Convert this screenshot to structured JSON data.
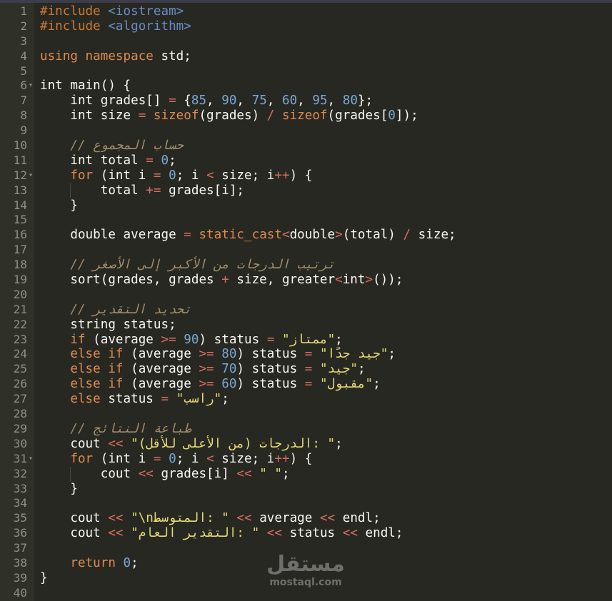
{
  "lines": [
    {
      "n": "1",
      "tokens": [
        {
          "t": "#include ",
          "c": "pp"
        },
        {
          "t": "<iostream>",
          "c": "inc"
        }
      ]
    },
    {
      "n": "2",
      "tokens": [
        {
          "t": "#include ",
          "c": "pp"
        },
        {
          "t": "<algorithm>",
          "c": "inc"
        }
      ]
    },
    {
      "n": "3",
      "tokens": []
    },
    {
      "n": "4",
      "tokens": [
        {
          "t": "using namespace ",
          "c": "kw"
        },
        {
          "t": "std;",
          "c": ""
        }
      ]
    },
    {
      "n": "5",
      "tokens": []
    },
    {
      "n": "6",
      "fold": true,
      "tokens": [
        {
          "t": "int main() {",
          "c": ""
        }
      ]
    },
    {
      "n": "7",
      "tokens": [
        {
          "t": "    int grades[] ",
          "c": ""
        },
        {
          "t": "=",
          "c": "op"
        },
        {
          "t": " {",
          "c": ""
        },
        {
          "t": "85",
          "c": "num"
        },
        {
          "t": ", ",
          "c": ""
        },
        {
          "t": "90",
          "c": "num"
        },
        {
          "t": ", ",
          "c": ""
        },
        {
          "t": "75",
          "c": "num"
        },
        {
          "t": ", ",
          "c": ""
        },
        {
          "t": "60",
          "c": "num"
        },
        {
          "t": ", ",
          "c": ""
        },
        {
          "t": "95",
          "c": "num"
        },
        {
          "t": ", ",
          "c": ""
        },
        {
          "t": "80",
          "c": "num"
        },
        {
          "t": "};",
          "c": ""
        }
      ]
    },
    {
      "n": "8",
      "tokens": [
        {
          "t": "    int size ",
          "c": ""
        },
        {
          "t": "=",
          "c": "op"
        },
        {
          "t": " ",
          "c": ""
        },
        {
          "t": "sizeof",
          "c": "kw"
        },
        {
          "t": "(grades) ",
          "c": ""
        },
        {
          "t": "/",
          "c": "op"
        },
        {
          "t": " ",
          "c": ""
        },
        {
          "t": "sizeof",
          "c": "kw"
        },
        {
          "t": "(grades[",
          "c": ""
        },
        {
          "t": "0",
          "c": "num"
        },
        {
          "t": "]);",
          "c": ""
        }
      ]
    },
    {
      "n": "9",
      "tokens": []
    },
    {
      "n": "10",
      "tokens": [
        {
          "t": "    ",
          "c": ""
        },
        {
          "t": "// حساب المجموع",
          "c": "cm"
        }
      ]
    },
    {
      "n": "11",
      "tokens": [
        {
          "t": "    int total ",
          "c": ""
        },
        {
          "t": "=",
          "c": "op"
        },
        {
          "t": " ",
          "c": ""
        },
        {
          "t": "0",
          "c": "num"
        },
        {
          "t": ";",
          "c": ""
        }
      ]
    },
    {
      "n": "12",
      "fold": true,
      "tokens": [
        {
          "t": "    ",
          "c": ""
        },
        {
          "t": "for",
          "c": "kw"
        },
        {
          "t": " (int i ",
          "c": ""
        },
        {
          "t": "=",
          "c": "op"
        },
        {
          "t": " ",
          "c": ""
        },
        {
          "t": "0",
          "c": "num"
        },
        {
          "t": "; i ",
          "c": ""
        },
        {
          "t": "<",
          "c": "op"
        },
        {
          "t": " size; i",
          "c": ""
        },
        {
          "t": "++",
          "c": "op"
        },
        {
          "t": ") {",
          "c": ""
        }
      ]
    },
    {
      "n": "13",
      "tokens": [
        {
          "t": "        total ",
          "c": ""
        },
        {
          "t": "+=",
          "c": "op"
        },
        {
          "t": " grades[i];",
          "c": ""
        }
      ]
    },
    {
      "n": "14",
      "tokens": [
        {
          "t": "    }",
          "c": ""
        }
      ]
    },
    {
      "n": "15",
      "tokens": []
    },
    {
      "n": "16",
      "tokens": [
        {
          "t": "    double average ",
          "c": ""
        },
        {
          "t": "=",
          "c": "op"
        },
        {
          "t": " ",
          "c": ""
        },
        {
          "t": "static_cast",
          "c": "kw"
        },
        {
          "t": "<",
          "c": "op"
        },
        {
          "t": "double",
          "c": ""
        },
        {
          "t": ">",
          "c": "op"
        },
        {
          "t": "(total) ",
          "c": ""
        },
        {
          "t": "/",
          "c": "op"
        },
        {
          "t": " size;",
          "c": ""
        }
      ]
    },
    {
      "n": "17",
      "tokens": []
    },
    {
      "n": "18",
      "tokens": [
        {
          "t": "    ",
          "c": ""
        },
        {
          "t": "// ترتيب الدرجات من الأكبر إلى الأصغر",
          "c": "cm"
        }
      ]
    },
    {
      "n": "19",
      "tokens": [
        {
          "t": "    sort(grades, grades ",
          "c": ""
        },
        {
          "t": "+",
          "c": "op"
        },
        {
          "t": " size, greater",
          "c": ""
        },
        {
          "t": "<",
          "c": "op"
        },
        {
          "t": "int",
          "c": ""
        },
        {
          "t": ">",
          "c": "op"
        },
        {
          "t": "());",
          "c": ""
        }
      ]
    },
    {
      "n": "20",
      "tokens": []
    },
    {
      "n": "21",
      "tokens": [
        {
          "t": "    ",
          "c": ""
        },
        {
          "t": "// تحديد التقدير",
          "c": "cm"
        }
      ]
    },
    {
      "n": "22",
      "tokens": [
        {
          "t": "    string status;",
          "c": ""
        }
      ]
    },
    {
      "n": "23",
      "tokens": [
        {
          "t": "    ",
          "c": ""
        },
        {
          "t": "if",
          "c": "kw"
        },
        {
          "t": " (average ",
          "c": ""
        },
        {
          "t": ">=",
          "c": "op"
        },
        {
          "t": " ",
          "c": ""
        },
        {
          "t": "90",
          "c": "num"
        },
        {
          "t": ") status ",
          "c": ""
        },
        {
          "t": "=",
          "c": "op"
        },
        {
          "t": " ",
          "c": ""
        },
        {
          "t": "\"ممتاز\"",
          "c": "str"
        },
        {
          "t": ";",
          "c": ""
        }
      ]
    },
    {
      "n": "24",
      "tokens": [
        {
          "t": "    ",
          "c": ""
        },
        {
          "t": "else if",
          "c": "kw"
        },
        {
          "t": " (average ",
          "c": ""
        },
        {
          "t": ">=",
          "c": "op"
        },
        {
          "t": " ",
          "c": ""
        },
        {
          "t": "80",
          "c": "num"
        },
        {
          "t": ") status ",
          "c": ""
        },
        {
          "t": "=",
          "c": "op"
        },
        {
          "t": " ",
          "c": ""
        },
        {
          "t": "\"جيد جدًا\"",
          "c": "str"
        },
        {
          "t": ";",
          "c": ""
        }
      ]
    },
    {
      "n": "25",
      "tokens": [
        {
          "t": "    ",
          "c": ""
        },
        {
          "t": "else if",
          "c": "kw"
        },
        {
          "t": " (average ",
          "c": ""
        },
        {
          "t": ">=",
          "c": "op"
        },
        {
          "t": " ",
          "c": ""
        },
        {
          "t": "70",
          "c": "num"
        },
        {
          "t": ") status ",
          "c": ""
        },
        {
          "t": "=",
          "c": "op"
        },
        {
          "t": " ",
          "c": ""
        },
        {
          "t": "\"جيد\"",
          "c": "str"
        },
        {
          "t": ";",
          "c": ""
        }
      ]
    },
    {
      "n": "26",
      "tokens": [
        {
          "t": "    ",
          "c": ""
        },
        {
          "t": "else if",
          "c": "kw"
        },
        {
          "t": " (average ",
          "c": ""
        },
        {
          "t": ">=",
          "c": "op"
        },
        {
          "t": " ",
          "c": ""
        },
        {
          "t": "60",
          "c": "num"
        },
        {
          "t": ") status ",
          "c": ""
        },
        {
          "t": "=",
          "c": "op"
        },
        {
          "t": " ",
          "c": ""
        },
        {
          "t": "\"مقبول\"",
          "c": "str"
        },
        {
          "t": ";",
          "c": ""
        }
      ]
    },
    {
      "n": "27",
      "tokens": [
        {
          "t": "    ",
          "c": ""
        },
        {
          "t": "else",
          "c": "kw"
        },
        {
          "t": " status ",
          "c": ""
        },
        {
          "t": "=",
          "c": "op"
        },
        {
          "t": " ",
          "c": ""
        },
        {
          "t": "\"راسب\"",
          "c": "str"
        },
        {
          "t": ";",
          "c": ""
        }
      ]
    },
    {
      "n": "28",
      "tokens": []
    },
    {
      "n": "29",
      "tokens": [
        {
          "t": "    ",
          "c": ""
        },
        {
          "t": "// طباعة النتائج",
          "c": "cm"
        }
      ]
    },
    {
      "n": "30",
      "tokens": [
        {
          "t": "    cout ",
          "c": ""
        },
        {
          "t": "<<",
          "c": "op"
        },
        {
          "t": " ",
          "c": ""
        },
        {
          "t": "\"الدرجات (من الأعلى للأقل): \"",
          "c": "str"
        },
        {
          "t": ";",
          "c": ""
        }
      ]
    },
    {
      "n": "31",
      "fold": true,
      "tokens": [
        {
          "t": "    ",
          "c": ""
        },
        {
          "t": "for",
          "c": "kw"
        },
        {
          "t": " (int i ",
          "c": ""
        },
        {
          "t": "=",
          "c": "op"
        },
        {
          "t": " ",
          "c": ""
        },
        {
          "t": "0",
          "c": "num"
        },
        {
          "t": "; i ",
          "c": ""
        },
        {
          "t": "<",
          "c": "op"
        },
        {
          "t": " size; i",
          "c": ""
        },
        {
          "t": "++",
          "c": "op"
        },
        {
          "t": ") {",
          "c": ""
        }
      ]
    },
    {
      "n": "32",
      "tokens": [
        {
          "t": "        cout ",
          "c": ""
        },
        {
          "t": "<<",
          "c": "op"
        },
        {
          "t": " grades[i] ",
          "c": ""
        },
        {
          "t": "<<",
          "c": "op"
        },
        {
          "t": " ",
          "c": ""
        },
        {
          "t": "\" \"",
          "c": "str"
        },
        {
          "t": ";",
          "c": ""
        }
      ]
    },
    {
      "n": "33",
      "tokens": [
        {
          "t": "    }",
          "c": ""
        }
      ]
    },
    {
      "n": "34",
      "tokens": []
    },
    {
      "n": "35",
      "tokens": [
        {
          "t": "    cout ",
          "c": ""
        },
        {
          "t": "<<",
          "c": "op"
        },
        {
          "t": " ",
          "c": ""
        },
        {
          "t": "\"\\nالمتوسط: \"",
          "c": "str"
        },
        {
          "t": " ",
          "c": ""
        },
        {
          "t": "<<",
          "c": "op"
        },
        {
          "t": " average ",
          "c": ""
        },
        {
          "t": "<<",
          "c": "op"
        },
        {
          "t": " endl;",
          "c": ""
        }
      ]
    },
    {
      "n": "36",
      "tokens": [
        {
          "t": "    cout ",
          "c": ""
        },
        {
          "t": "<<",
          "c": "op"
        },
        {
          "t": " ",
          "c": ""
        },
        {
          "t": "\"التقدير العام: \"",
          "c": "str"
        },
        {
          "t": " ",
          "c": ""
        },
        {
          "t": "<<",
          "c": "op"
        },
        {
          "t": " status ",
          "c": ""
        },
        {
          "t": "<<",
          "c": "op"
        },
        {
          "t": " endl;",
          "c": ""
        }
      ]
    },
    {
      "n": "37",
      "tokens": []
    },
    {
      "n": "38",
      "tokens": [
        {
          "t": "    ",
          "c": ""
        },
        {
          "t": "return",
          "c": "kw"
        },
        {
          "t": " ",
          "c": ""
        },
        {
          "t": "0",
          "c": "num"
        },
        {
          "t": ";",
          "c": ""
        }
      ]
    },
    {
      "n": "39",
      "tokens": [
        {
          "t": "}",
          "c": ""
        }
      ]
    },
    {
      "n": "40",
      "tokens": []
    }
  ],
  "watermark": {
    "logo": "مستقل",
    "url": "mostaql.com"
  }
}
